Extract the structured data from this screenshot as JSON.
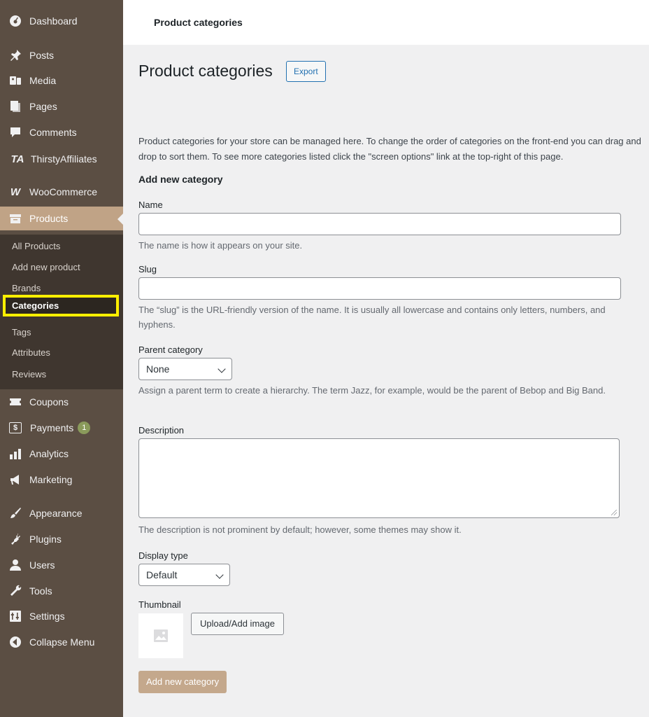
{
  "colors": {
    "sidebar_bg": "#5b4e43",
    "submenu_bg": "#3f362f",
    "active_item_bg": "#c0a386",
    "highlight_border": "#ffef00",
    "primary_button_bg": "#c4a88c",
    "link_blue": "#2271b1"
  },
  "sidebar": {
    "items": [
      {
        "label": "Dashboard",
        "icon": "dashboard-icon"
      },
      {
        "label": "Posts",
        "icon": "pin-icon"
      },
      {
        "label": "Media",
        "icon": "media-icon"
      },
      {
        "label": "Pages",
        "icon": "pages-icon"
      },
      {
        "label": "Comments",
        "icon": "comment-icon"
      },
      {
        "label": "ThirstyAffiliates",
        "icon": "thirstyaffiliates-logo-icon",
        "icon_text": "TA"
      },
      {
        "label": "WooCommerce",
        "icon": "woocommerce-icon",
        "icon_text": "W"
      },
      {
        "label": "Products",
        "icon": "archive-icon",
        "active": true
      },
      {
        "label": "Coupons",
        "icon": "ticket-icon"
      },
      {
        "label": "Payments",
        "icon": "payments-icon",
        "badge": "1",
        "icon_text": "$"
      },
      {
        "label": "Analytics",
        "icon": "bar-chart-icon"
      },
      {
        "label": "Marketing",
        "icon": "megaphone-icon"
      },
      {
        "label": "Appearance",
        "icon": "paintbrush-icon"
      },
      {
        "label": "Plugins",
        "icon": "plug-icon"
      },
      {
        "label": "Users",
        "icon": "user-icon"
      },
      {
        "label": "Tools",
        "icon": "wrench-icon"
      },
      {
        "label": "Settings",
        "icon": "settings-icon"
      },
      {
        "label": "Collapse Menu",
        "icon": "collapse-arrow-icon"
      }
    ],
    "submenu": [
      {
        "label": "All Products"
      },
      {
        "label": "Add new product"
      },
      {
        "label": "Brands"
      },
      {
        "label": "Categories",
        "current": true
      },
      {
        "label": "Tags"
      },
      {
        "label": "Attributes"
      },
      {
        "label": "Reviews"
      }
    ]
  },
  "topbar": {
    "title": "Product categories"
  },
  "main": {
    "heading": "Product categories",
    "export_label": "Export",
    "intro": "Product categories for your store can be managed here. To change the order of categories on the front-end you can drag and drop to sort them. To see more categories listed click the \"screen options\" link at the top-right of this page.",
    "form_heading": "Add new category",
    "name_label": "Name",
    "name_value": "",
    "name_help": "The name is how it appears on your site.",
    "slug_label": "Slug",
    "slug_value": "",
    "slug_help": "The “slug” is the URL-friendly version of the name. It is usually all lowercase and contains only letters, numbers, and hyphens.",
    "parent_label": "Parent category",
    "parent_value": "None",
    "parent_help": "Assign a parent term to create a hierarchy. The term Jazz, for example, would be the parent of Bebop and Big Band.",
    "description_label": "Description",
    "description_value": "",
    "description_help": "The description is not prominent by default; however, some themes may show it.",
    "display_type_label": "Display type",
    "display_type_value": "Default",
    "thumbnail_label": "Thumbnail",
    "upload_label": "Upload/Add image",
    "submit_label": "Add new category"
  }
}
